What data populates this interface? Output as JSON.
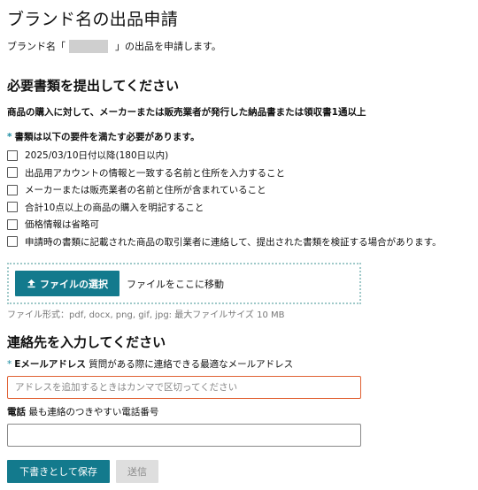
{
  "page": {
    "title": "ブランド名の出品申請",
    "brand_prefix": "ブランド名「",
    "brand_suffix": "」の出品を申請します。"
  },
  "documents": {
    "heading": "必要書類を提出してください",
    "description": "商品の購入に対して、メーカーまたは販売業者が発行した納品書または領収書1通以上",
    "requirements_star": "*",
    "requirements_note": "書類は以下の要件を満たす必要があります。",
    "requirements": [
      {
        "label": "2025/03/10日付以降(180日以内)",
        "checked": false
      },
      {
        "label": "出品用アカウントの情報と一致する名前と住所を入力すること",
        "checked": false
      },
      {
        "label": "メーカーまたは販売業者の名前と住所が含まれていること",
        "checked": false
      },
      {
        "label": "合計10点以上の商品の購入を明記すること",
        "checked": false
      },
      {
        "label": "価格情報は省略可",
        "checked": false
      },
      {
        "label": "申請時の書類に記載された商品の取引業者に連絡して、提出された書類を検証する場合があります。",
        "checked": false
      }
    ],
    "upload_button_label": "ファイルの選択",
    "upload_icon": "upload-icon",
    "drop_text": "ファイルをここに移動",
    "file_format_note": "ファイル形式：pdf, docx, png, gif, jpg: 最大ファイルサイズ 10 MB"
  },
  "contact": {
    "heading": "連絡先を入力してください",
    "email_star": "*",
    "email_label": "Eメールアドレス",
    "email_hint": "質問がある際に連絡できる最適なメールアドレス",
    "email_value": "",
    "email_placeholder": "アドレスを追加するときはカンマで区切ってください",
    "phone_label": "電話",
    "phone_hint": "最も連絡のつきやすい電話番号",
    "phone_value": ""
  },
  "actions": {
    "save_draft_label": "下書きとして保存",
    "submit_label": "送信"
  },
  "colors": {
    "accent": "#137a8d",
    "required_star": "#1a8ca2",
    "error_border": "#e06133",
    "disabled_bg": "#dedede",
    "upload_border": "#9fc9c9"
  }
}
